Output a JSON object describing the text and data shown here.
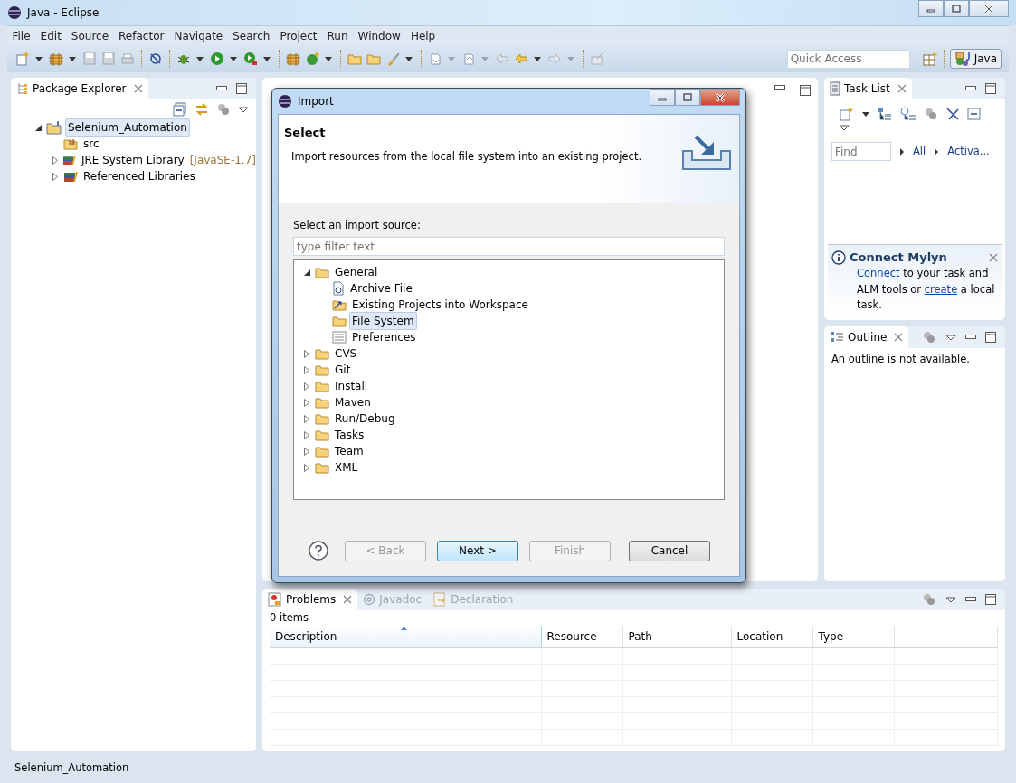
{
  "window": {
    "title": "Java - Eclipse"
  },
  "menu": [
    "File",
    "Edit",
    "Source",
    "Refactor",
    "Navigate",
    "Search",
    "Project",
    "Run",
    "Window",
    "Help"
  ],
  "quick_access": {
    "placeholder": "Quick Access"
  },
  "perspective": {
    "label": "Java",
    "selected": true
  },
  "package_explorer": {
    "tab": "Package Explorer",
    "tree": [
      {
        "label": "Selenium_Automation",
        "kind": "project",
        "expandable": true,
        "expanded": true,
        "selected": true,
        "children": [
          {
            "label": "src",
            "kind": "source",
            "expandable": false,
            "selected": false
          },
          {
            "label": "JRE System Library",
            "suffix": "[JavaSE-1.7]",
            "kind": "library",
            "expandable": true,
            "expanded": false,
            "selected": false
          },
          {
            "label": "Referenced Libraries",
            "kind": "library",
            "expandable": true,
            "expanded": false,
            "selected": false
          }
        ]
      }
    ]
  },
  "dialog": {
    "title": "Import",
    "heading": "Select",
    "description": "Import resources from the local file system into an existing project.",
    "source_label": "Select an import source:",
    "filter": {
      "placeholder": "type filter text"
    },
    "tree": [
      {
        "label": "General",
        "kind": "folder",
        "expandable": true,
        "expanded": true,
        "selected": false,
        "children": [
          {
            "label": "Archive File",
            "kind": "archive",
            "expandable": false,
            "selected": false
          },
          {
            "label": "Existing Projects into Workspace",
            "kind": "projects",
            "expandable": false,
            "selected": false
          },
          {
            "label": "File System",
            "kind": "folder",
            "expandable": false,
            "selected": true
          },
          {
            "label": "Preferences",
            "kind": "prefs",
            "expandable": false,
            "selected": false
          }
        ]
      },
      {
        "label": "CVS",
        "kind": "folder",
        "expandable": true,
        "expanded": false,
        "selected": false
      },
      {
        "label": "Git",
        "kind": "folder",
        "expandable": true,
        "expanded": false,
        "selected": false
      },
      {
        "label": "Install",
        "kind": "folder",
        "expandable": true,
        "expanded": false,
        "selected": false
      },
      {
        "label": "Maven",
        "kind": "folder",
        "expandable": true,
        "expanded": false,
        "selected": false
      },
      {
        "label": "Run/Debug",
        "kind": "folder",
        "expandable": true,
        "expanded": false,
        "selected": false
      },
      {
        "label": "Tasks",
        "kind": "folder",
        "expandable": true,
        "expanded": false,
        "selected": false
      },
      {
        "label": "Team",
        "kind": "folder",
        "expandable": true,
        "expanded": false,
        "selected": false
      },
      {
        "label": "XML",
        "kind": "folder",
        "expandable": true,
        "expanded": false,
        "selected": false
      }
    ],
    "buttons": [
      {
        "label": "< Back",
        "disabled": true,
        "default": false
      },
      {
        "label": "Next >",
        "disabled": false,
        "default": true
      },
      {
        "label": "Finish",
        "disabled": true,
        "default": false
      },
      {
        "label": "Cancel",
        "disabled": false,
        "default": false
      }
    ]
  },
  "task_list": {
    "tab": "Task List",
    "find": {
      "placeholder": "Find"
    },
    "filters": [
      "All",
      "Activa..."
    ]
  },
  "mylyn": {
    "title": "Connect Mylyn",
    "text": [
      {
        "text": "Connect",
        "link": true
      },
      {
        "text": " to your task and ALM tools or ",
        "link": false
      },
      {
        "text": "create",
        "link": true
      },
      {
        "text": " a local task.",
        "link": false
      }
    ]
  },
  "outline": {
    "tab": "Outline",
    "message": "An outline is not available."
  },
  "problems": {
    "tabs": [
      {
        "label": "Problems",
        "selected": true
      },
      {
        "label": "Javadoc",
        "selected": false
      },
      {
        "label": "Declaration",
        "selected": false
      }
    ],
    "count": "0 items",
    "columns": [
      {
        "label": "Description",
        "sorted": true
      },
      {
        "label": "Resource",
        "sorted": false
      },
      {
        "label": "Path",
        "sorted": false
      },
      {
        "label": "Location",
        "sorted": false
      },
      {
        "label": "Type",
        "sorted": false
      }
    ]
  },
  "status_bar": {
    "text": "Selenium_Automation"
  }
}
